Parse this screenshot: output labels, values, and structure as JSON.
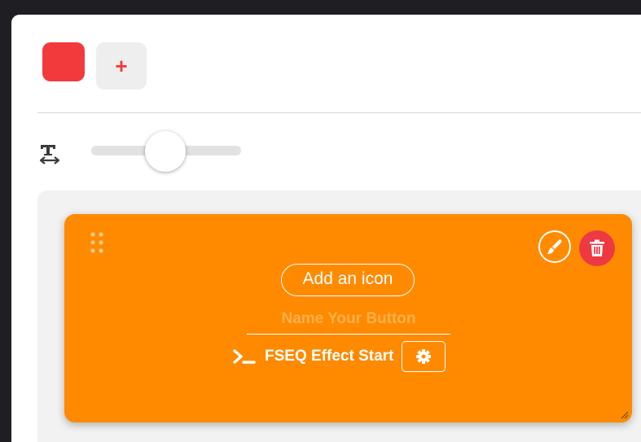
{
  "colors": {
    "page_bg": "#1f1f23",
    "swatch": "#f23a3c",
    "card": "#ff8a00",
    "delete": "#ee3942",
    "placeholder": "#ffb04d"
  },
  "palette": {
    "add_color_glyph": "+",
    "add_color_icon": "plus-icon"
  },
  "size_slider": {
    "icon": "text-width-icon",
    "value_fraction": 0.5
  },
  "card": {
    "drag_icon": "drag-dots-icon",
    "style_icon": "paintbrush-icon",
    "delete_icon": "trash-icon",
    "add_icon_label": "Add an icon",
    "name_placeholder": "Name Your Button",
    "name_value": "",
    "action_icon": "terminal-icon",
    "action_label": "FSEQ Effect Start",
    "settings_icon": "gear-icon",
    "resize_icon": "resize-handle-icon"
  }
}
